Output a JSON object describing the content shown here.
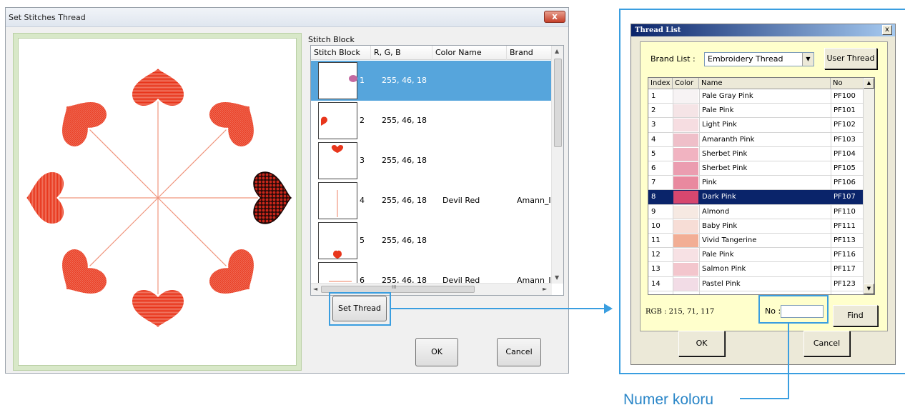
{
  "set_stitches_dialog": {
    "title": "Set Stitches Thread",
    "close_label": "x",
    "group_label": "Stitch Block",
    "columns": [
      "Stitch Block",
      "R, G, B",
      "Color Name",
      "Brand"
    ],
    "rows": [
      {
        "index": "1",
        "rgb": "255, 46, 18",
        "color_name": "",
        "brand": ""
      },
      {
        "index": "2",
        "rgb": "255, 46, 18",
        "color_name": "",
        "brand": ""
      },
      {
        "index": "3",
        "rgb": "255, 46, 18",
        "color_name": "",
        "brand": ""
      },
      {
        "index": "4",
        "rgb": "255, 46, 18",
        "color_name": "Devil Red",
        "brand": "Amann_Isa"
      },
      {
        "index": "5",
        "rgb": "255, 46, 18",
        "color_name": "",
        "brand": ""
      },
      {
        "index": "6",
        "rgb": "255, 46, 18",
        "color_name": "Devil Red",
        "brand": "Amann_Isa"
      }
    ],
    "hscroll_glyph": "III",
    "set_thread_label": "Set Thread",
    "ok_label": "OK",
    "cancel_label": "Cancel",
    "colors": {
      "heart": "#e8361c",
      "selection": "#56a5dc"
    }
  },
  "thread_list_dialog": {
    "title": "Thread List",
    "close_label": "x",
    "brand_list_label": "Brand List :",
    "brand_list_value": "Embroidery Thread",
    "user_thread_label": "User Thread",
    "columns": [
      "Index",
      "Color",
      "Name",
      "No"
    ],
    "rows": [
      {
        "index": "1",
        "color": "#f7f3f4",
        "name": "Pale Gray Pink",
        "no": "PF100"
      },
      {
        "index": "2",
        "color": "#f5e4e6",
        "name": "Pale Pink",
        "no": "PF101"
      },
      {
        "index": "3",
        "color": "#f6dde1",
        "name": "Light Pink",
        "no": "PF102"
      },
      {
        "index": "4",
        "color": "#efbfc9",
        "name": "Amaranth Pink",
        "no": "PF103"
      },
      {
        "index": "5",
        "color": "#f1b3c1",
        "name": "Sherbet Pink",
        "no": "PF104"
      },
      {
        "index": "6",
        "color": "#eb9db0",
        "name": "Sherbet Pink",
        "no": "PF105"
      },
      {
        "index": "7",
        "color": "#e9899f",
        "name": "Pink",
        "no": "PF106"
      },
      {
        "index": "8",
        "color": "#d7476f",
        "name": "Dark Pink",
        "no": "PF107"
      },
      {
        "index": "9",
        "color": "#f6e9e2",
        "name": "Almond",
        "no": "PF110"
      },
      {
        "index": "10",
        "color": "#f7ddd6",
        "name": "Baby Pink",
        "no": "PF111"
      },
      {
        "index": "11",
        "color": "#f2ae95",
        "name": "Vivid Tangerine",
        "no": "PF113"
      },
      {
        "index": "12",
        "color": "#f7e1e4",
        "name": "Pale Pink",
        "no": "PF116"
      },
      {
        "index": "13",
        "color": "#f3c6cd",
        "name": "Salmon Pink",
        "no": "PF117"
      },
      {
        "index": "14",
        "color": "#f2dce6",
        "name": "Pastel Pink",
        "no": "PF123"
      }
    ],
    "selected_row": 8,
    "rgb_text": "RGB : 215, 71, 117",
    "no_label": "No :",
    "no_value": "",
    "find_label": "Find",
    "ok_label": "OK",
    "cancel_label": "Cancel"
  },
  "annotation_caption": "Numer koloru"
}
